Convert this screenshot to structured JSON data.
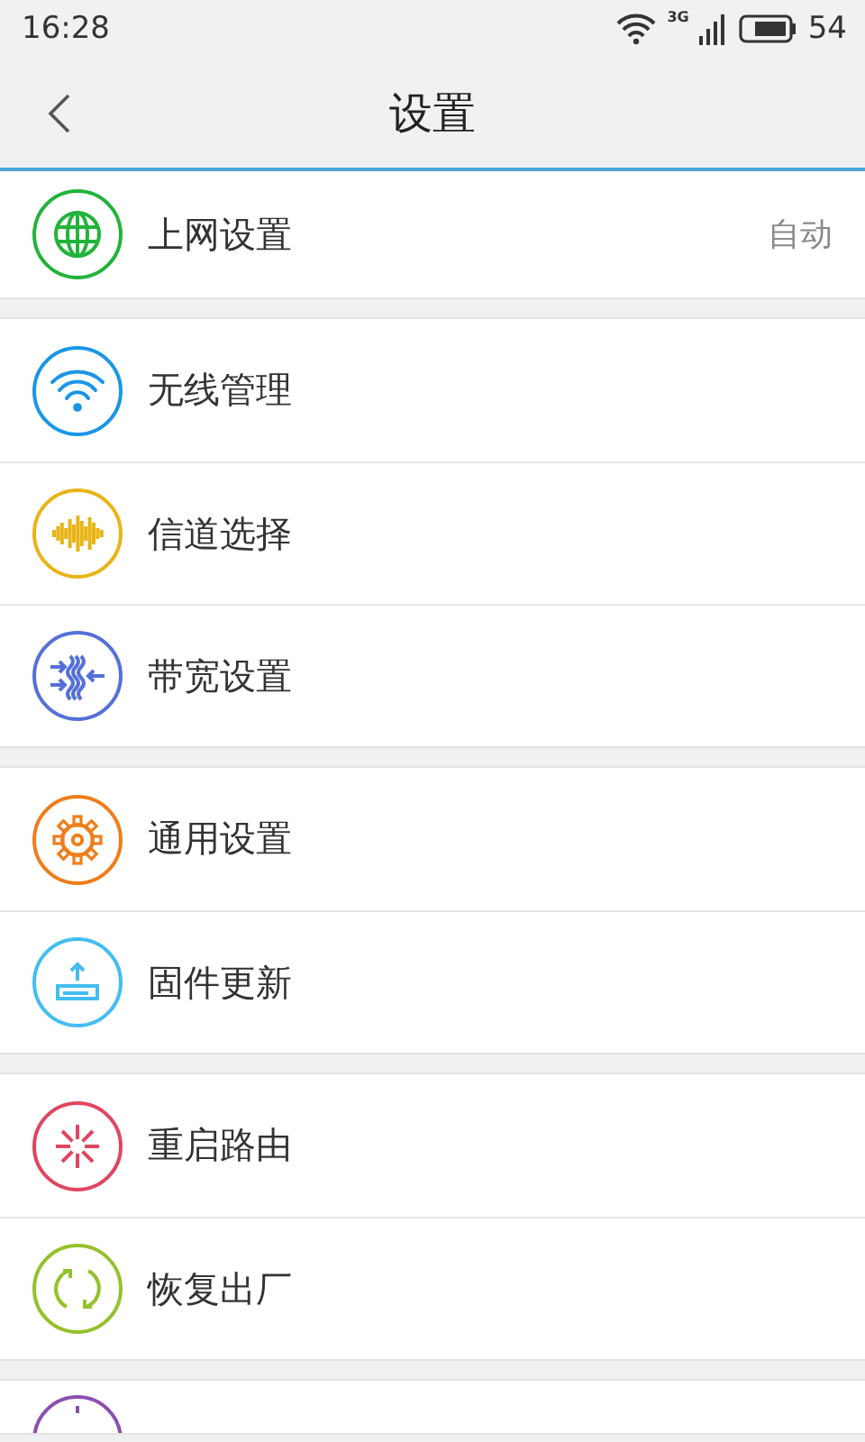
{
  "status_bar": {
    "time": "16:28",
    "network": "3G",
    "battery": "54"
  },
  "header": {
    "title": "设置"
  },
  "groups": [
    {
      "items": [
        {
          "kind": "globe",
          "color": "#22b33a",
          "label": "上网设置",
          "value": "自动"
        }
      ]
    },
    {
      "items": [
        {
          "kind": "wifi",
          "color": "#1a96e6",
          "label": "无线管理"
        },
        {
          "kind": "wave",
          "color": "#e8b417",
          "label": "信道选择"
        },
        {
          "kind": "bandwidth",
          "color": "#5470d8",
          "label": "带宽设置"
        }
      ]
    },
    {
      "items": [
        {
          "kind": "gear",
          "color": "#ef7d1a",
          "label": "通用设置"
        },
        {
          "kind": "upload",
          "color": "#43bdf0",
          "label": "固件更新"
        }
      ]
    },
    {
      "items": [
        {
          "kind": "burst",
          "color": "#e04560",
          "label": "重启路由"
        },
        {
          "kind": "refresh",
          "color": "#95c12c",
          "label": "恢复出厂"
        }
      ]
    },
    {
      "items": [
        {
          "kind": "partial",
          "color": "#8b4fb0"
        }
      ]
    }
  ]
}
